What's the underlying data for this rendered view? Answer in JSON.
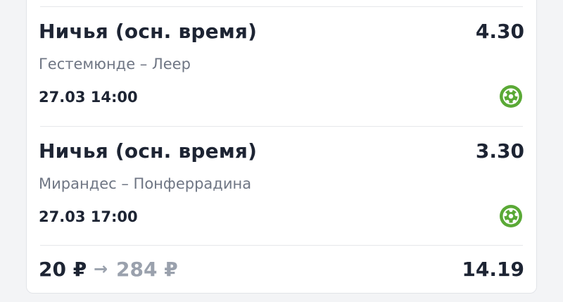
{
  "colors": {
    "text_primary": "#1d2433",
    "text_secondary": "#6f7684",
    "payout_gray": "#9aa1ad",
    "sport_green": "#5aa936"
  },
  "bets": [
    {
      "market": "Ничья (осн. время)",
      "odds": "4.30",
      "match": "Гестемюнде – Леер",
      "datetime": "27.03 14:00",
      "sport_icon": "football-icon"
    },
    {
      "market": "Ничья (осн. время)",
      "odds": "3.30",
      "match": "Мирандес – Понферрадина",
      "datetime": "27.03 17:00",
      "sport_icon": "football-icon"
    }
  ],
  "footer": {
    "stake": "20 ₽",
    "arrow": "→",
    "payout": "284 ₽",
    "total_odds": "14.19"
  }
}
